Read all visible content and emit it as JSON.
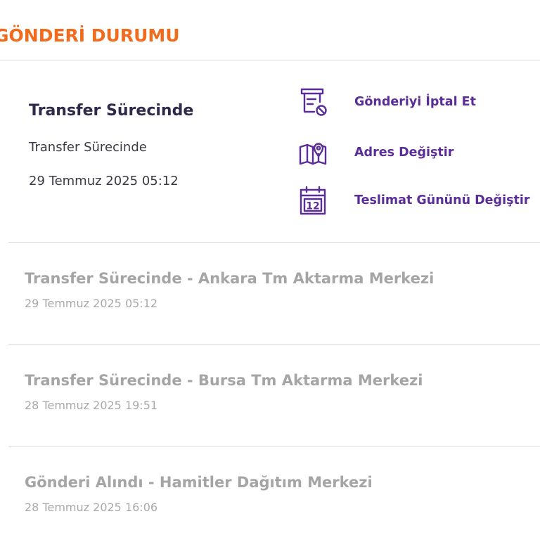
{
  "section": {
    "title": "GÖNDERİ DURUMU"
  },
  "current": {
    "title": "Transfer Sürecinde",
    "status": "Transfer Sürecinde",
    "date": "29 Temmuz 2025 05:12"
  },
  "actions": [
    {
      "label": "Gönderiyi İptal Et",
      "icon": "cancel-document-icon"
    },
    {
      "label": "Adres Değiştir",
      "icon": "map-pin-icon"
    },
    {
      "label": "Teslimat Gününü Değiştir",
      "icon": "calendar-icon",
      "calendar_day": "12"
    }
  ],
  "history": [
    {
      "title": "Transfer Sürecinde - Ankara Tm Aktarma Merkezi",
      "date": "29 Temmuz 2025 05:12"
    },
    {
      "title": "Transfer Sürecinde - Bursa Tm Aktarma Merkezi",
      "date": "28 Temmuz 2025 19:51"
    },
    {
      "title": "Gönderi Alındı - Hamitler Dağıtım Merkezi",
      "date": "28 Temmuz 2025 16:06"
    }
  ],
  "colors": {
    "title_orange": "#f26a1b",
    "action_purple": "#5b2d96",
    "current_text": "#2e2a4a",
    "history_gray": "#a5a5a5",
    "divider": "#d9d9d9"
  }
}
